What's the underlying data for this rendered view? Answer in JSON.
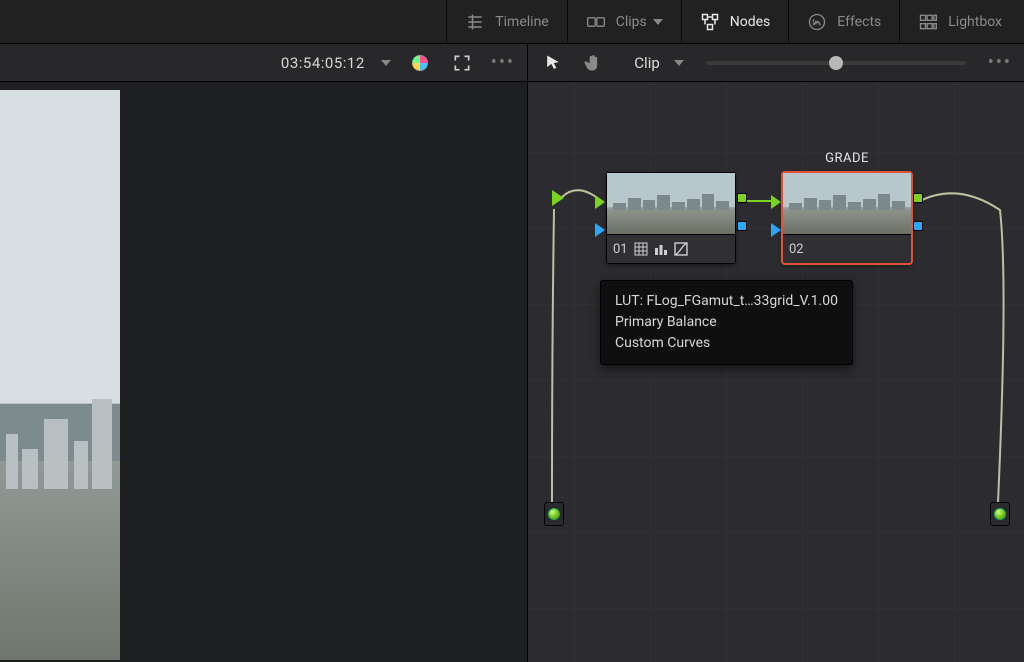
{
  "topbar": {
    "timeline": "Timeline",
    "clips": "Clips",
    "nodes": "Nodes",
    "effects": "Effects",
    "lightbox": "Lightbox"
  },
  "secondbar": {
    "timecode": "03:54:05:12",
    "clip_label": "Clip"
  },
  "nodes": {
    "node1": {
      "num": "01",
      "label": ""
    },
    "node2": {
      "num": "02",
      "label": "GRADE"
    }
  },
  "tooltip": {
    "line1": "LUT: FLog_FGamut_t…33grid_V.1.00",
    "line2": "Primary Balance",
    "line3": "Custom Curves"
  }
}
